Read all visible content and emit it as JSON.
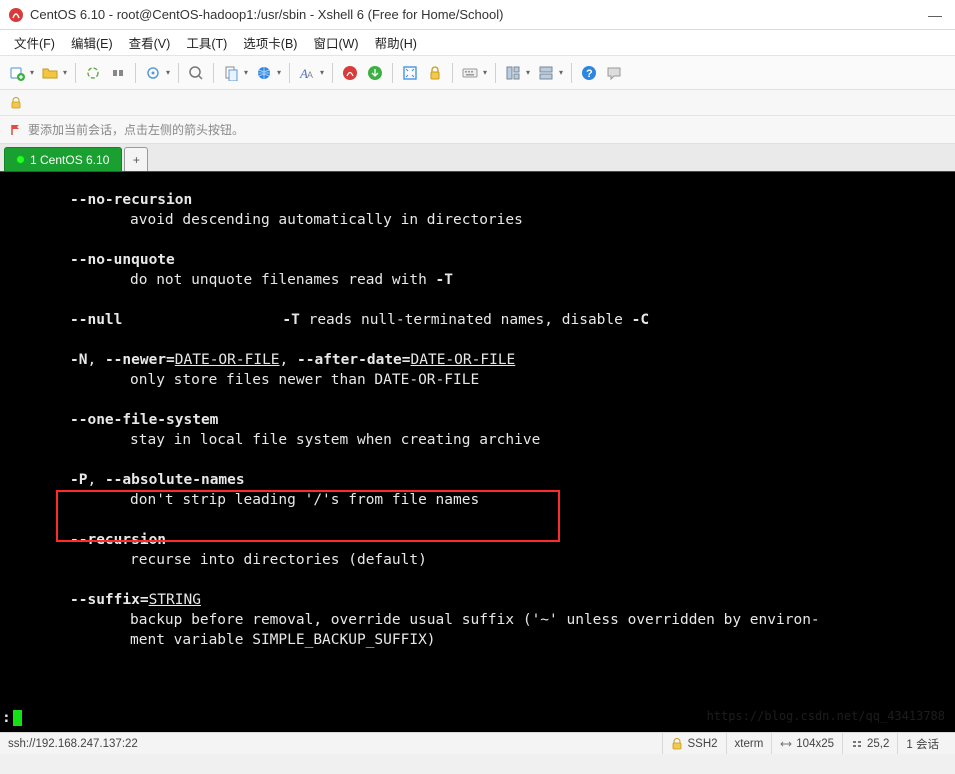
{
  "window": {
    "title": "CentOS 6.10 - root@CentOS-hadoop1:/usr/sbin - Xshell 6 (Free for Home/School)",
    "minimize": "—"
  },
  "menu": {
    "file": "文件(F)",
    "edit": "编辑(E)",
    "view": "查看(V)",
    "tools": "工具(T)",
    "tabs": "选项卡(B)",
    "window": "窗口(W)",
    "help": "帮助(H)"
  },
  "info": {
    "text": "要添加当前会话，点击左侧的箭头按钮。"
  },
  "tabs": {
    "active": "1 CentOS 6.10",
    "add": "+"
  },
  "term": {
    "opt_norecursion": "--no-recursion",
    "desc_norecursion": "avoid descending automatically in directories",
    "opt_nounquote": "--no-unquote",
    "desc_nounquote_pre": "do not unquote filenames read with ",
    "desc_nounquote_flag": "-T",
    "opt_null": "--null",
    "desc_null_flag": "-T",
    "desc_null_mid": " reads null-terminated names, disable ",
    "desc_null_flag2": "-C",
    "opt_newer_N": "-N",
    "opt_newer_sep": ", ",
    "opt_newer_long": "--newer=",
    "opt_newer_arg": "DATE-OR-FILE",
    "opt_newer_sep2": ", ",
    "opt_after": "--after-date=",
    "opt_after_arg": "DATE-OR-FILE",
    "desc_newer": "only store files newer than DATE-OR-FILE",
    "opt_onefs": "--one-file-system",
    "desc_onefs": "stay in local file system when creating archive",
    "opt_P": "-P",
    "opt_P_sep": ", ",
    "opt_absnames": "--absolute-names",
    "desc_absnames": "don't strip leading '/'s from file names",
    "opt_recursion": "--recursion",
    "desc_recursion": "recurse into directories (default)",
    "opt_suffix": "--suffix=",
    "opt_suffix_arg": "STRING",
    "desc_suffix1": "backup before removal, override usual suffix ('~' unless overridden by environ-",
    "desc_suffix2": "ment variable SIMPLE_BACKUP_SUFFIX)",
    "prompt": ":"
  },
  "status": {
    "conn": "ssh://192.168.247.137:22",
    "proto": "SSH2",
    "term": "xterm",
    "size": "104x25",
    "pos": "25,2",
    "sess": "1 会话"
  },
  "watermark": "https://blog.csdn.net/qq_43413788"
}
